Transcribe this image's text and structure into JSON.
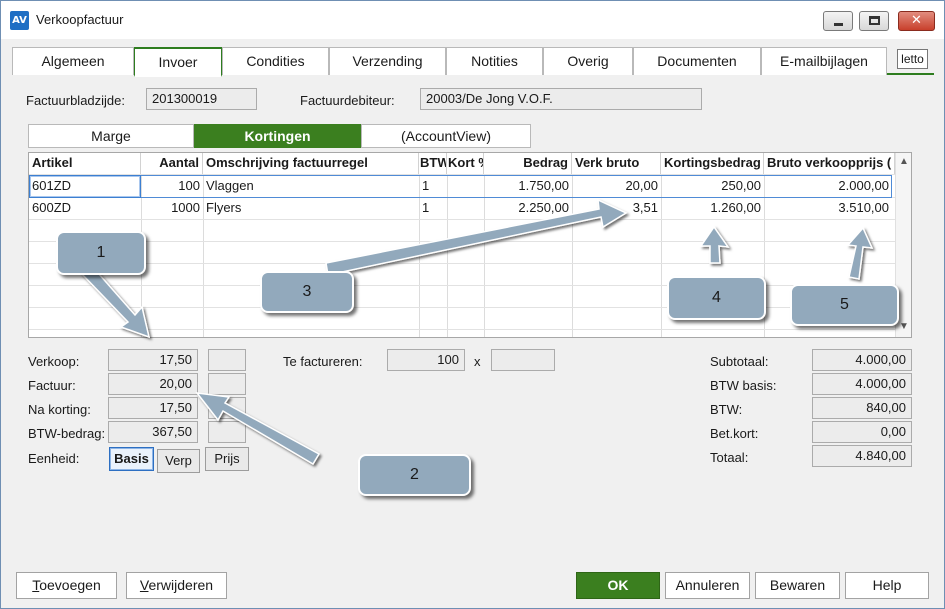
{
  "window": {
    "logo": "AV",
    "title": "Verkoopfactuur"
  },
  "tabs": [
    "Algemeen",
    "Invoer",
    "Condities",
    "Verzending",
    "Notities",
    "Overig",
    "Documenten",
    "E-mailbijlagen",
    "letto"
  ],
  "header": {
    "page_label": "Factuurbladzijde:",
    "page_value": "201300019",
    "debtor_label": "Factuurdebiteur:",
    "debtor_value": "20003/De Jong V.O.F."
  },
  "subtabs": [
    "Marge",
    "Kortingen",
    "(AccountView)"
  ],
  "grid": {
    "columns": [
      "Artikel",
      "Aantal",
      "Omschrijving factuurregel",
      "BTW",
      "Kort %",
      "Bedrag",
      "Verk bruto",
      "Kortingsbedrag",
      "Bruto verkoopprijs ("
    ],
    "rows": [
      {
        "artikel": "601ZD",
        "aantal": "100",
        "omschrijving": "Vlaggen",
        "btw": "1",
        "kort": "",
        "bedrag": "1.750,00",
        "verk_bruto": "20,00",
        "kortingsbedrag": "250,00",
        "bruto_verkoopprijs": "2.000,00"
      },
      {
        "artikel": "600ZD",
        "aantal": "1000",
        "omschrijving": "Flyers",
        "btw": "1",
        "kort": "",
        "bedrag": "2.250,00",
        "verk_bruto": "3,51",
        "kortingsbedrag": "1.260,00",
        "bruto_verkoopprijs": "3.510,00"
      }
    ]
  },
  "callouts": [
    "1",
    "2",
    "3",
    "4",
    "5"
  ],
  "left_panel": {
    "verkoop_label": "Verkoop:",
    "verkoop_value": "17,50",
    "factuur_label": "Factuur:",
    "factuur_value": "20,00",
    "na_korting_label": "Na korting:",
    "na_korting_value": "17,50",
    "btw_bedrag_label": "BTW-bedrag:",
    "btw_bedrag_value": "367,50",
    "eenheid_label": "Eenheid:",
    "unit_buttons": [
      "Basis",
      "Verp",
      "Prijs"
    ]
  },
  "middle_panel": {
    "te_factureren_label": "Te factureren:",
    "te_factureren_value": "100",
    "multiply": "x"
  },
  "totals": {
    "subtotaal_label": "Subtotaal:",
    "subtotaal_value": "4.000,00",
    "btw_basis_label": "BTW basis:",
    "btw_basis_value": "4.000,00",
    "btw_label": "BTW:",
    "btw_value": "840,00",
    "betkort_label": "Bet.kort:",
    "betkort_value": "0,00",
    "totaal_label": "Totaal:",
    "totaal_value": "4.840,00"
  },
  "buttons": {
    "toevoegen_first": "T",
    "toevoegen_rest": "oevoegen",
    "verwijderen_first": "V",
    "verwijderen_rest": "erwijderen",
    "ok": "OK",
    "annuleren": "Annuleren",
    "bewaren": "Bewaren",
    "help": "Help"
  },
  "colors": {
    "accent_green": "#3b7f1f",
    "callout_fill": "#92a9bc",
    "selection_blue": "#3c7fd1"
  }
}
